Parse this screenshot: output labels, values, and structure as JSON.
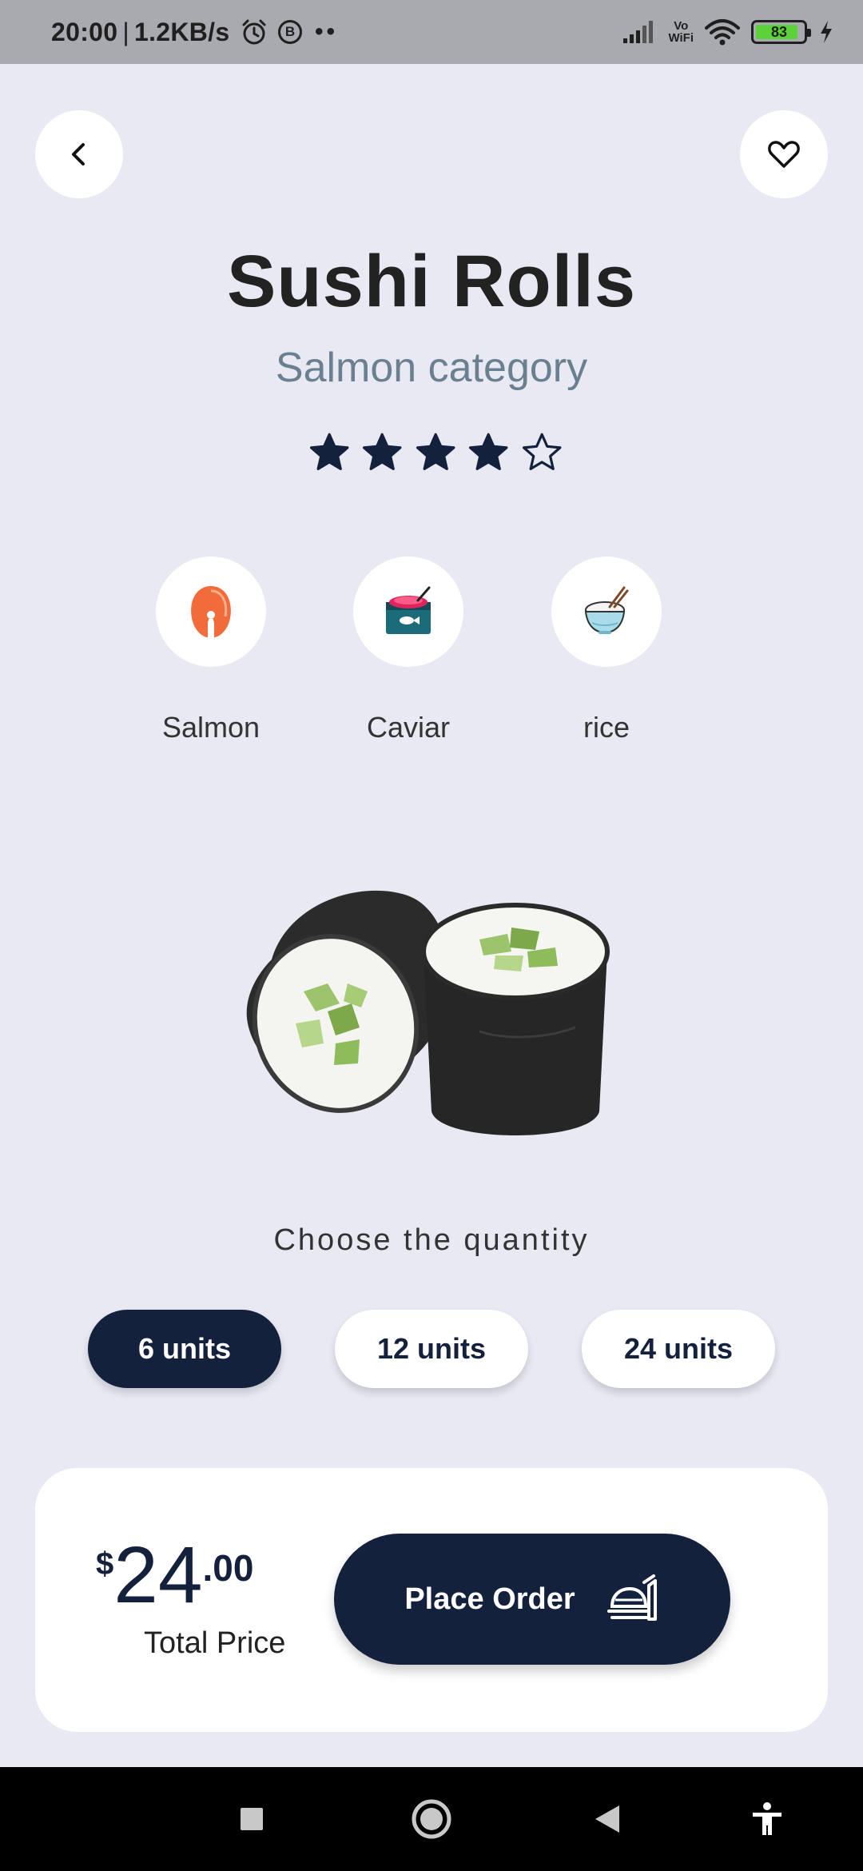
{
  "status_bar": {
    "time": "20:00",
    "separator": "|",
    "net_speed": "1.2KB/s",
    "alarm_icon": "alarm-icon",
    "b_icon_letter": "B",
    "dots": "••",
    "vowifi_top": "Vo",
    "vowifi_bottom": "WiFi",
    "battery_level": "83"
  },
  "header": {
    "back_icon": "chevron-left-icon",
    "favorite_icon": "heart-outline-icon"
  },
  "product": {
    "title": "Sushi Rolls",
    "subtitle": "Salmon category",
    "rating": 4,
    "rating_max": 5
  },
  "ingredients": [
    {
      "label": "Salmon",
      "icon": "salmon-steak-icon"
    },
    {
      "label": "Caviar",
      "icon": "caviar-tin-icon"
    },
    {
      "label": "rice",
      "icon": "rice-bowl-icon"
    }
  ],
  "quantity": {
    "label": "Choose the quantity",
    "options": [
      "6 units",
      "12 units",
      "24 units"
    ],
    "selected": "6 units"
  },
  "order": {
    "currency": "$",
    "price_int": "24",
    "price_dec": ".00",
    "caption": "Total Price",
    "button_label": "Place Order",
    "button_icon": "food-serving-icon"
  },
  "colors": {
    "background": "#e8e9f3",
    "primary": "#14213d",
    "subtitle": "#6a8090"
  },
  "nav": {
    "recent_icon": "square-icon",
    "home_icon": "circle-icon",
    "back_icon": "triangle-back-icon",
    "accessibility_icon": "accessibility-icon"
  }
}
